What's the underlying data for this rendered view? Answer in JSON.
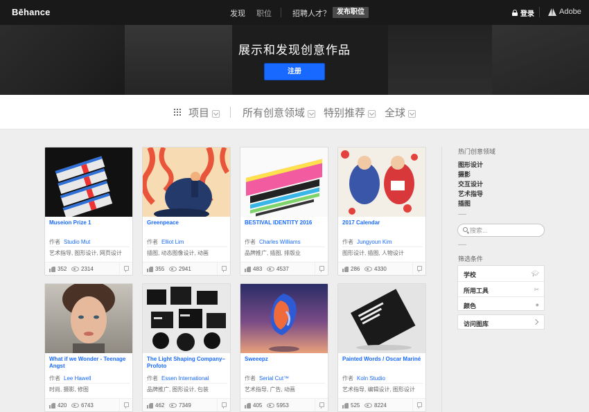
{
  "topbar": {
    "logo": "Bēhance",
    "nav_find": "发现",
    "nav_jobs": "职位",
    "nav_hire": "招聘人才？",
    "post_job": "发布职位",
    "login": "登录",
    "adobe": "Adobe"
  },
  "hero": {
    "title": "展示和发现创意作品",
    "signup": "注册"
  },
  "filters": {
    "projects": "项目",
    "fields": "所有创意领域",
    "featured": "特别推荐",
    "global": "全球"
  },
  "owner_prefix": "作者",
  "cards": [
    {
      "title": "Museion Prize 1",
      "owner": "Studio Mut",
      "fields": "艺术指导, 图形设计, 网页设计",
      "appreciations": "352",
      "views": "2314"
    },
    {
      "title": "Greenpeace",
      "owner": "Elliot Lim",
      "fields": "插图, 动态图像设计, 动画",
      "appreciations": "355",
      "views": "2941"
    },
    {
      "title": "BESTIVAL IDENTITY 2016",
      "owner": "Charles Williams",
      "fields": "品牌推广, 插图, 排版业",
      "appreciations": "483",
      "views": "4537"
    },
    {
      "title": "2017 Calendar",
      "owner": "Jungyoun Kim",
      "fields": "图形设计, 插图, 人物设计",
      "appreciations": "286",
      "views": "4330"
    },
    {
      "title": "What if we Wonder - Teenage Angst",
      "owner": "Lee Hawell",
      "fields": "时尚, 摄影, 修图",
      "appreciations": "420",
      "views": "6743"
    },
    {
      "title": "The Light Shaping Company– Profoto",
      "owner": "Essen International",
      "fields": "品牌推广, 图形设计, 包装",
      "appreciations": "462",
      "views": "7349"
    },
    {
      "title": "Sweeepz",
      "owner": "Serial Cut™",
      "fields": "艺术指导, 广告, 动画",
      "appreciations": "405",
      "views": "5953"
    },
    {
      "title": "Painted Words / Oscar Mariné",
      "owner": "Koln Studio",
      "fields": "艺术指导, 编辑设计, 图形设计",
      "appreciations": "525",
      "views": "8224"
    }
  ],
  "sidebar": {
    "popular_heading": "热门创意领域",
    "popular": [
      "图形设计",
      "摄影",
      "交互设计",
      "艺术指导",
      "插图"
    ],
    "search_placeholder": "搜索...",
    "filter_heading": "筛选条件",
    "facets": [
      "学校",
      "所用工具",
      "颜色"
    ],
    "gallery": "访问图库"
  },
  "colors": {
    "accent": "#1769ff",
    "topbar": "#191919",
    "page_bg": "#eeeeee"
  }
}
